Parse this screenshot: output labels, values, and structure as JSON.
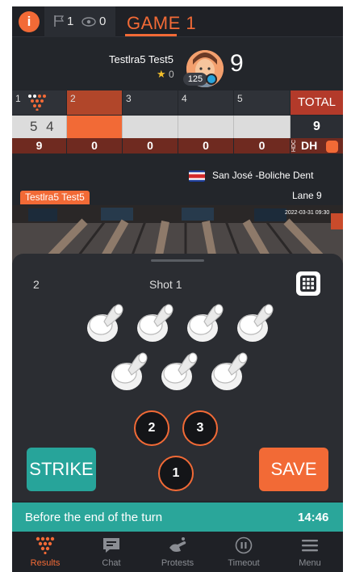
{
  "header": {
    "flag_count": "1",
    "viewer_count": "0",
    "game_tab": "GAME 1"
  },
  "player": {
    "name": "Testlra5 Test5",
    "stars": "0",
    "avatar_badge": "125",
    "score": "9"
  },
  "scorecard": {
    "frames": [
      {
        "number": "1",
        "balls": "5 4",
        "total": "9",
        "active": false
      },
      {
        "number": "2",
        "balls": "",
        "total": "0",
        "active": true
      },
      {
        "number": "3",
        "balls": "",
        "total": "0",
        "active": false
      },
      {
        "number": "4",
        "balls": "",
        "total": "0",
        "active": false
      },
      {
        "number": "5",
        "balls": "",
        "total": "0",
        "active": false
      }
    ],
    "total_label": "TOTAL",
    "total_value": "9",
    "hdc_label": "HDC",
    "dh_label": "DH"
  },
  "location": {
    "venue": "San José -Boliche Dent",
    "player_tag": "Testlra5 Test5",
    "lane": "Lane 9"
  },
  "camera": {
    "timestamp": "2022-03-31 09:30"
  },
  "shot_panel": {
    "frame": "2",
    "shot": "Shot 1",
    "remaining_pins": [
      "2",
      "3",
      "1"
    ],
    "strike_label": "STRIKE",
    "save_label": "SAVE"
  },
  "timer": {
    "message": "Before the end of the turn",
    "value": "14:46"
  },
  "nav": {
    "items": [
      {
        "label": "Results",
        "icon": "pins-icon",
        "active": true
      },
      {
        "label": "Chat",
        "icon": "chat-icon",
        "active": false
      },
      {
        "label": "Protests",
        "icon": "protest-icon",
        "active": false
      },
      {
        "label": "Timeout",
        "icon": "pause-icon",
        "active": false
      },
      {
        "label": "Menu",
        "icon": "menu-icon",
        "active": false
      }
    ]
  },
  "colors": {
    "accent": "#f26a36",
    "teal": "#27a49a",
    "background": "#23262b"
  }
}
